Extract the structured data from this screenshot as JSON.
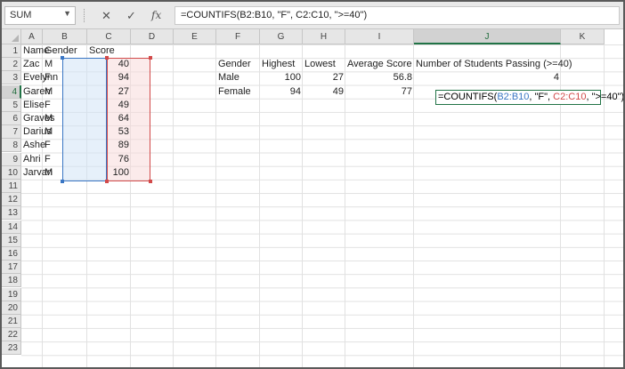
{
  "formula_bar": {
    "name_box": "SUM",
    "cancel_symbol": "✕",
    "enter_symbol": "✓",
    "fx_symbol": "fx",
    "formula": "=COUNTIFS(B2:B10, \"F\", C2:C10, \">=40\")"
  },
  "columns": [
    "A",
    "B",
    "C",
    "D",
    "E",
    "F",
    "G",
    "H",
    "I",
    "J",
    "K"
  ],
  "rows": [
    "1",
    "2",
    "3",
    "4",
    "5",
    "6",
    "7",
    "8",
    "9",
    "10",
    "11",
    "12",
    "13",
    "14",
    "15",
    "16",
    "17",
    "18",
    "19",
    "20",
    "21",
    "22",
    "23"
  ],
  "selected": {
    "column": "J",
    "row": "4"
  },
  "table": {
    "headers": [
      "Name",
      "Gender",
      "Score"
    ],
    "rows": [
      [
        "Zac",
        "M",
        "40"
      ],
      [
        "Evelynn",
        "F",
        "94"
      ],
      [
        "Garen",
        "M",
        "27"
      ],
      [
        "Elise",
        "F",
        "49"
      ],
      [
        "Graves",
        "M",
        "64"
      ],
      [
        "Darius",
        "M",
        "53"
      ],
      [
        "Ashe",
        "F",
        "89"
      ],
      [
        "Ahri",
        "F",
        "76"
      ],
      [
        "Jarvan",
        "M",
        "100"
      ]
    ]
  },
  "summary": {
    "headers": [
      "Gender",
      "Highest",
      "Lowest",
      "Average Score",
      "Number of Students Passing (>=40)"
    ],
    "rows": [
      [
        "Male",
        "100",
        "27",
        "56.8",
        "4"
      ],
      [
        "Female",
        "94",
        "49",
        "77",
        ""
      ]
    ]
  },
  "edit_cell": {
    "prefix": "=COUNTIFS(",
    "ref1": "B2:B10",
    "mid": ", \"F\", ",
    "ref2": "C2:C10",
    "suffix": ", \">=40\")"
  }
}
